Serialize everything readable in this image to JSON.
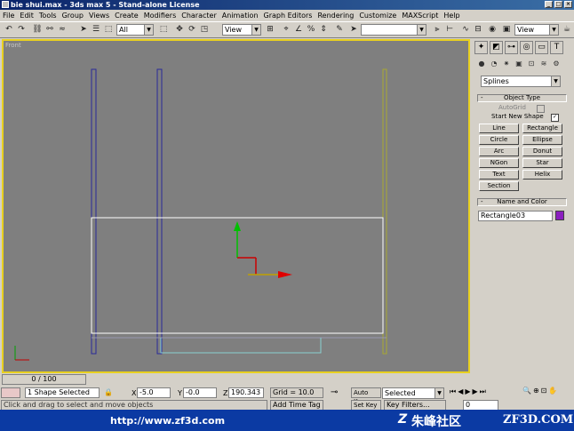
{
  "window": {
    "title": "bie shui.max - 3ds max 5 - Stand-alone License"
  },
  "menu": [
    "File",
    "Edit",
    "Tools",
    "Group",
    "Views",
    "Create",
    "Modifiers",
    "Character",
    "Animation",
    "Graph Editors",
    "Rendering",
    "Customize",
    "MAXScript",
    "Help"
  ],
  "toolbar": {
    "selection_filter": "All",
    "ref_coord": "View",
    "named_sel": "",
    "view_combo": "View"
  },
  "viewport": {
    "label": "Front"
  },
  "command_panel": {
    "dropdown": "Splines",
    "object_type": {
      "header": "Object Type",
      "autogrid": "AutoGrid",
      "start_new_shape": "Start New Shape",
      "buttons": [
        "Line",
        "Rectangle",
        "Circle",
        "Ellipse",
        "Arc",
        "Donut",
        "NGon",
        "Star",
        "Text",
        "Helix",
        "Section"
      ]
    },
    "name_color": {
      "header": "Name and Color",
      "object_name": "Rectangle03",
      "color": "#8b1fbf"
    }
  },
  "timeline": {
    "frame_label": "0 / 100"
  },
  "status": {
    "selection": "1 Shape Selected",
    "x_label": "X",
    "x_value": "-5.0",
    "y_label": "Y",
    "y_value": "-0.0",
    "z_label": "Z",
    "z_value": "190.343",
    "grid": "Grid = 10.0",
    "auto_key": "Auto Key",
    "set_key": "Set Key",
    "selected": "Selected",
    "key_filters": "Key Filters...",
    "prompt": "Click and drag to select and move objects",
    "add_time_tag": "Add Time Tag",
    "frame": "0"
  },
  "banner": {
    "url": "http://www.zf3d.com",
    "brand": "朱峰社区",
    "site": "ZF3D.COM"
  },
  "colors": {
    "accent": "#0a246a",
    "viewport": "#7f7f7f",
    "selected_rect": "#ffffff",
    "selection_border": "#ffd700",
    "gizmo_y": "#00c000",
    "gizmo_x": "#e00000"
  }
}
